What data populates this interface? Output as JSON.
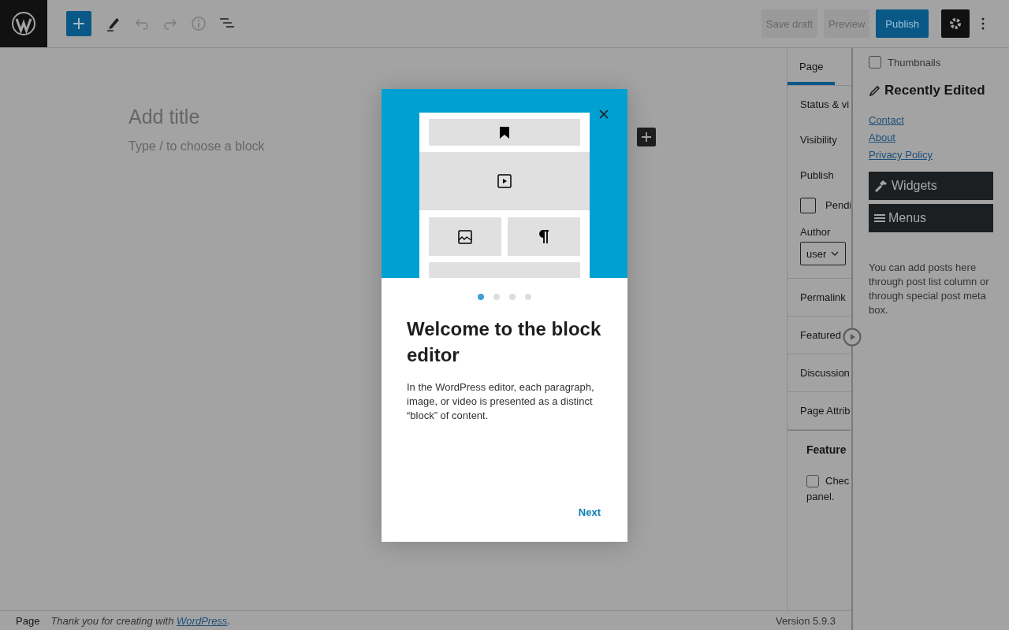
{
  "toolbar": {
    "buttons": [
      {
        "label": "Save draft",
        "kind": "secondary"
      },
      {
        "label": "Preview",
        "kind": "secondary"
      },
      {
        "label": "Publish",
        "kind": "primary"
      }
    ]
  },
  "editor": {
    "title_placeholder": "Add title",
    "block_placeholder": "Type / to choose a block"
  },
  "sidebar": {
    "tabs": [
      {
        "label": "Page",
        "selected": true
      }
    ],
    "summary": {
      "title": "Status & vi",
      "rows": [
        "Visibility",
        "Publish"
      ],
      "pending": {
        "label": "Pendi",
        "checked": false
      },
      "author": {
        "label": "Author",
        "value": "user"
      }
    },
    "sections": [
      "Permalink",
      "Featured",
      "Discussion",
      "Page Attrib"
    ],
    "meta_box": {
      "title": "Feature",
      "checkbox": {
        "label": "Chec",
        "checked": false
      },
      "text": "panel."
    }
  },
  "panel": {
    "thumbnails": {
      "label": "Thumbnails",
      "checked": false
    },
    "heading": "Recently Edited",
    "links": [
      "Contact",
      "About",
      "Privacy Policy"
    ],
    "menu_buttons": [
      {
        "label": "Widgets",
        "kind": "widgets"
      },
      {
        "label": "Menus",
        "kind": "menus"
      }
    ],
    "note": "You can add posts here through post list column or through special post meta box."
  },
  "modal": {
    "steps": [
      {
        "selected": true
      },
      {
        "selected": false
      },
      {
        "selected": false
      },
      {
        "selected": false
      }
    ],
    "heading": "Welcome to the block editor",
    "body": "In the WordPress editor, each paragraph, image, or video is presented as a distinct “block” of content.",
    "next": "Next"
  },
  "footer": {
    "breadcrumb": "Page",
    "thanks": "Thank you for creating with ",
    "link": "WordPress",
    "thanks_end": ".",
    "version": "Version 5.9.3"
  }
}
